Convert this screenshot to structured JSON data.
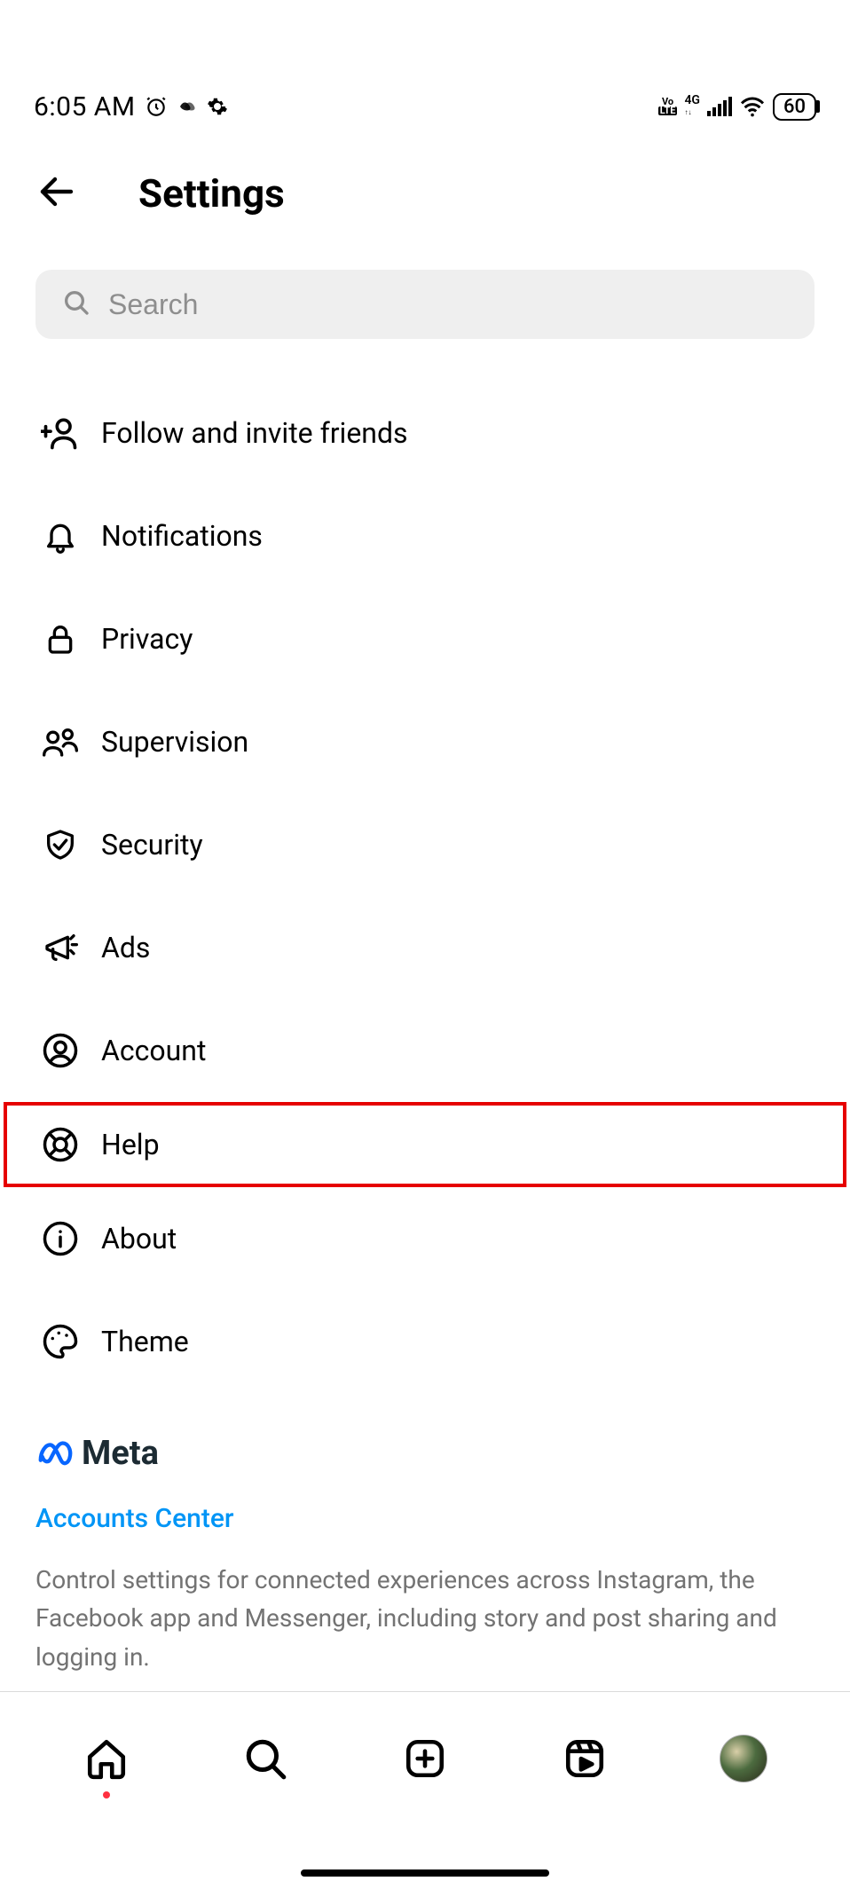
{
  "status": {
    "time": "6:05 AM",
    "battery": "60"
  },
  "header": {
    "title": "Settings"
  },
  "search": {
    "placeholder": "Search"
  },
  "menu": {
    "items": [
      {
        "label": "Follow and invite friends"
      },
      {
        "label": "Notifications"
      },
      {
        "label": "Privacy"
      },
      {
        "label": "Supervision"
      },
      {
        "label": "Security"
      },
      {
        "label": "Ads"
      },
      {
        "label": "Account"
      },
      {
        "label": "Help"
      },
      {
        "label": "About"
      },
      {
        "label": "Theme"
      }
    ]
  },
  "meta": {
    "brand": "Meta",
    "link": "Accounts Center",
    "description": "Control settings for connected experiences across Instagram, the Facebook app and Messenger, including story and post sharing and logging in."
  }
}
